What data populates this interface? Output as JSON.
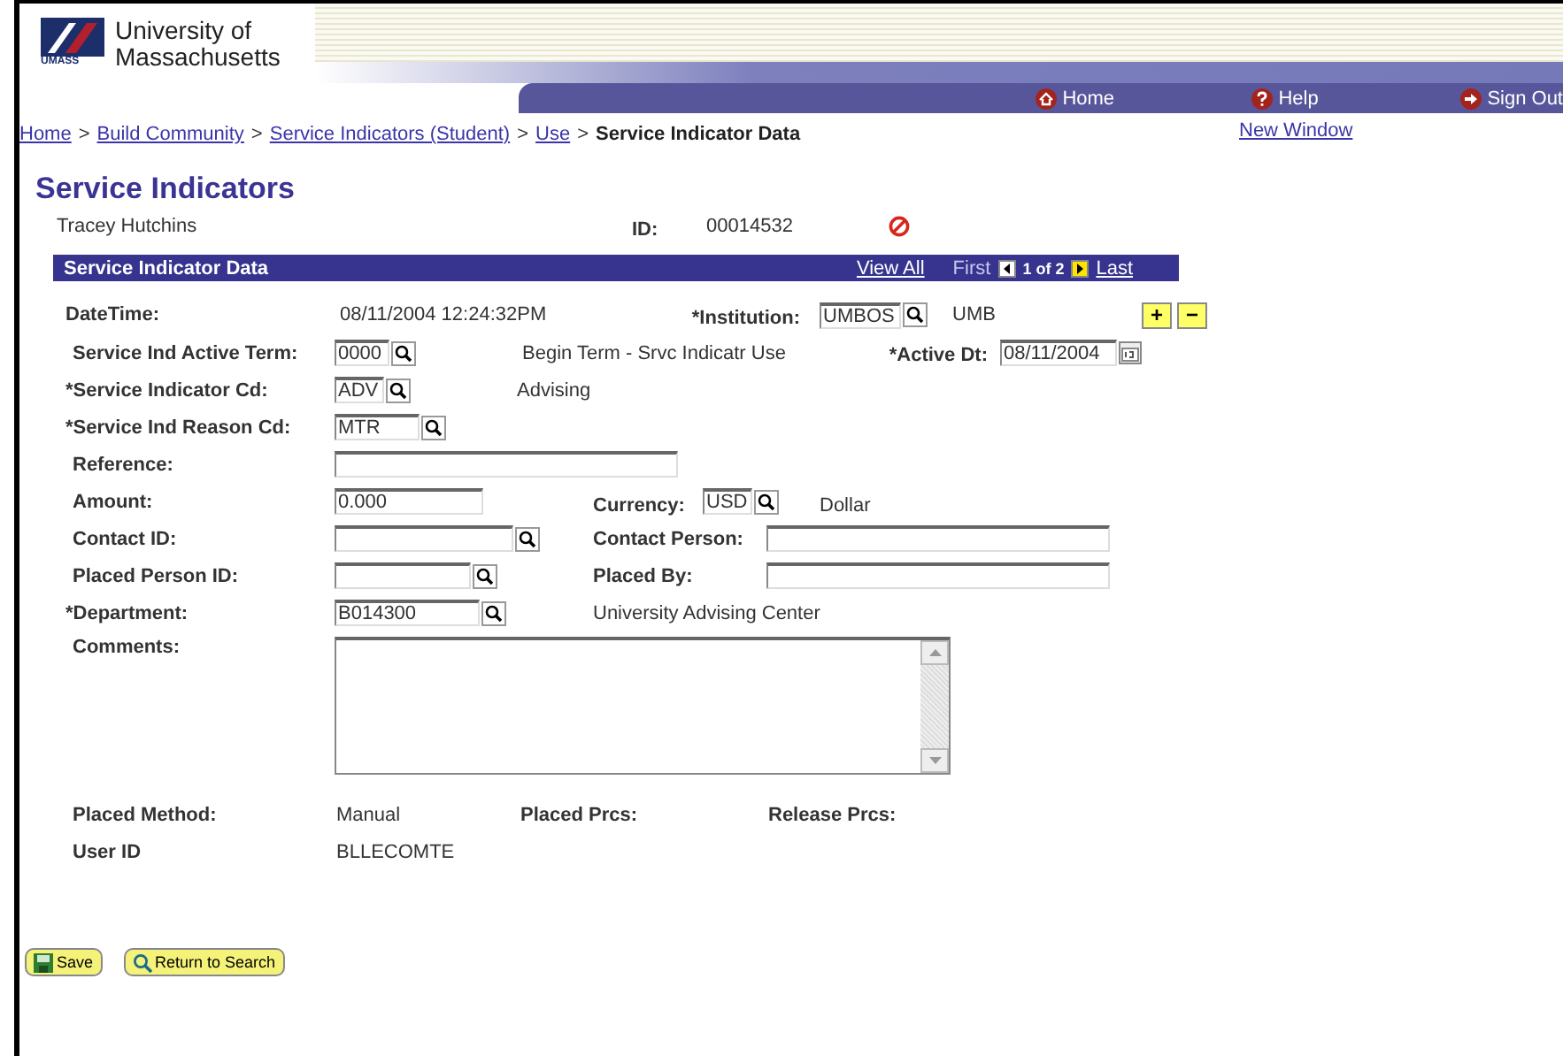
{
  "header": {
    "logo_line1": "University of",
    "logo_line2": "Massachusetts",
    "logo_mark": "UMASS",
    "nav": [
      {
        "label": "Home",
        "kind": "home"
      },
      {
        "label": "Help",
        "kind": "help"
      },
      {
        "label": "Sign Out",
        "kind": "signout"
      }
    ]
  },
  "breadcrumb": [
    {
      "label": "Home",
      "link": true
    },
    {
      "label": "Build Community",
      "link": true
    },
    {
      "label": "Service Indicators (Student)",
      "link": true
    },
    {
      "label": "Use",
      "link": true
    },
    {
      "label": "Service Indicator Data",
      "link": false
    }
  ],
  "breadcrumb_separator": ">",
  "new_window": "New Window",
  "page_title": "Service Indicators",
  "student_name": "Tracey Hutchins",
  "id_label": "ID:",
  "id_value": "00014532",
  "section": {
    "title": "Service Indicator Data",
    "view_all": "View All",
    "first": "First",
    "pager": "1 of 2",
    "last": "Last"
  },
  "row_buttons": [
    "+",
    "−"
  ],
  "fields": {
    "datetime": {
      "label": "DateTime:",
      "value": "08/11/2004 12:24:32PM"
    },
    "institution": {
      "label": "*Institution:",
      "value": "UMBOS",
      "description": "UMB"
    },
    "active_term": {
      "label": "Service Ind Active Term:",
      "value": "0000",
      "description": "Begin Term - Srvc Indicatr Use"
    },
    "active_dt": {
      "label": "*Active Dt:",
      "value": "08/11/2004"
    },
    "indicator_cd": {
      "label": "*Service Indicator Cd:",
      "value": "ADV",
      "description": "Advising"
    },
    "reason_cd": {
      "label": "*Service Ind Reason Cd:",
      "value": "MTR"
    },
    "reference": {
      "label": "Reference:"
    },
    "amount": {
      "label": "Amount:",
      "value": "0.000"
    },
    "currency": {
      "label": "Currency:",
      "value": "USD",
      "description": "Dollar"
    },
    "contact_id": {
      "label": "Contact ID:"
    },
    "contact_person": {
      "label": "Contact Person:"
    },
    "placed_person_id": {
      "label": "Placed Person ID:"
    },
    "placed_by": {
      "label": "Placed By:"
    },
    "department": {
      "label": "*Department:",
      "value": "B014300",
      "description": "University Advising Center"
    },
    "comments": {
      "label": "Comments:"
    },
    "placed_method": {
      "label": "Placed Method:",
      "value": "Manual"
    },
    "placed_prcs": {
      "label": "Placed Prcs:"
    },
    "release_prcs": {
      "label": "Release Prcs:"
    },
    "user_id": {
      "label": "User ID",
      "value": "BLLECOMTE"
    }
  },
  "buttons": [
    {
      "label": "Save",
      "kind": "save"
    },
    {
      "label": "Return to Search",
      "kind": "search"
    }
  ]
}
